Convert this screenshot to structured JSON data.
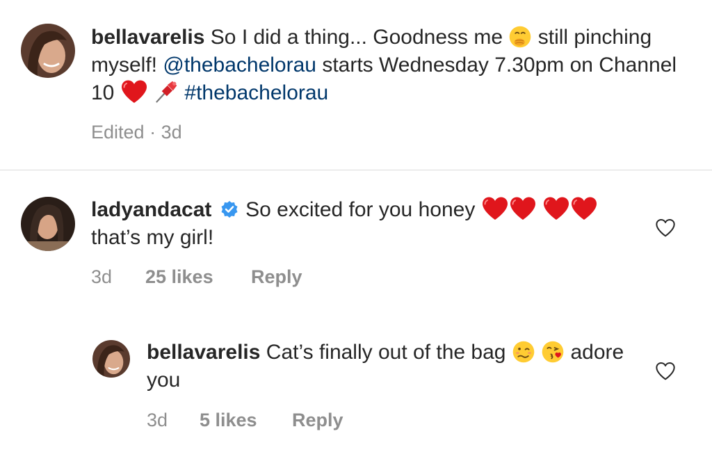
{
  "caption": {
    "username": "bellavarelis",
    "text_1": "So I did a thing... Goodness me",
    "emoji_1": "face-with-hand-over-mouth-emoji",
    "text_2": "still pinching myself!",
    "mention": "@thebachelorau",
    "text_3": "starts Wednesday 7.30pm on Channel 10",
    "emoji_2": "red-heart-emoji",
    "emoji_3": "pushpin-emoji",
    "hashtag": "#thebachelorau",
    "edited_label": "Edited",
    "separator": "·",
    "time": "3d"
  },
  "comments": [
    {
      "username": "ladyandacat",
      "verified": true,
      "text_1": "So excited for you honey",
      "text_2": "that’s my girl!",
      "emoji": "red-heart-emoji",
      "time": "3d",
      "likes": "25 likes",
      "reply_label": "Reply"
    },
    {
      "username": "bellavarelis",
      "text_1": "Cat’s finally out of the bag",
      "emoji_1": "woozy-face-emoji",
      "emoji_2": "face-blowing-kiss-emoji",
      "text_2": "adore you",
      "time": "3d",
      "likes": "5 likes",
      "reply_label": "Reply",
      "is_reply": true
    }
  ],
  "colors": {
    "text": "#262626",
    "secondary_text": "#8e8e8e",
    "link": "#00376b",
    "divider": "#dbdbdb",
    "heart_red": "#e0161c",
    "verified_blue": "#3897f0"
  },
  "icons": {
    "like": "heart-outline-icon",
    "verified": "verified-badge-icon"
  }
}
